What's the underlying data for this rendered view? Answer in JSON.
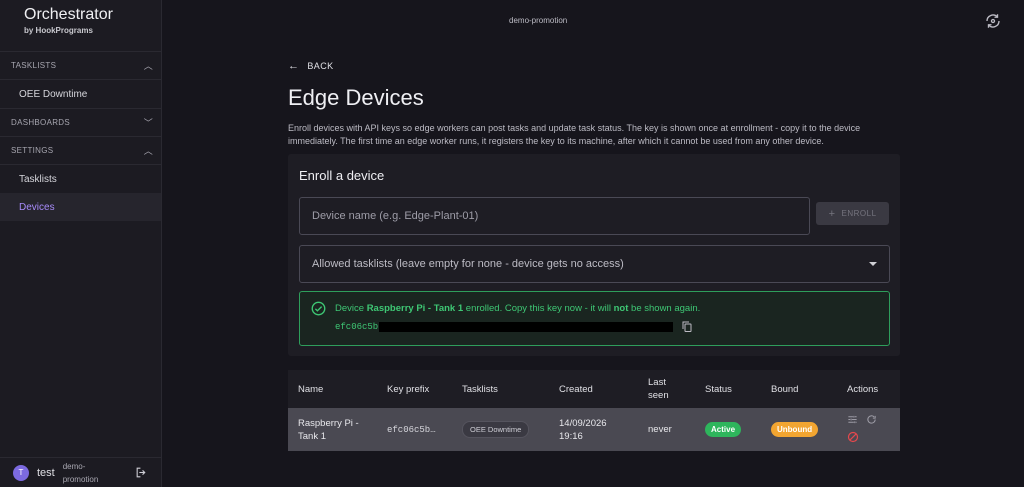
{
  "app": {
    "title": "Orchestrator",
    "subtitle": "by HookPrograms"
  },
  "topbar": {
    "workspace": "demo-promotion"
  },
  "sidebar": {
    "sections": [
      {
        "label": "TASKLISTS",
        "expanded": true,
        "items": [
          "OEE Downtime"
        ]
      },
      {
        "label": "DASHBOARDS",
        "expanded": false,
        "items": []
      },
      {
        "label": "SETTINGS",
        "expanded": true,
        "items": [
          "Tasklists",
          "Devices"
        ]
      }
    ],
    "active_item": "Devices"
  },
  "user": {
    "initial": "T",
    "name": "test",
    "org": "demo-promotion"
  },
  "page": {
    "back_label": "BACK",
    "title": "Edge Devices",
    "description": "Enroll devices with API keys so edge workers can post tasks and update task status. The key is shown once at enrollment - copy it to the device immediately. The first time an edge worker runs, it registers the key to its machine, after which it cannot be used from any other device."
  },
  "enroll": {
    "title": "Enroll a device",
    "name_placeholder": "Device name (e.g. Edge-Plant-01)",
    "name_value": "",
    "button_label": "ENROLL",
    "tasklists_placeholder": "Allowed tasklists (leave empty for none - device gets no access)",
    "success": {
      "prefix": "Device ",
      "device": "Raspberry Pi - Tank 1",
      "middle": " enrolled. Copy this key now - it will ",
      "emph": "not",
      "suffix": " be shown again.",
      "key_visible": "efc06c5b"
    }
  },
  "table": {
    "headers": [
      "Name",
      "Key prefix",
      "Tasklists",
      "Created",
      "Last seen",
      "Status",
      "Bound",
      "Actions"
    ],
    "rows": [
      {
        "name": "Raspberry Pi - Tank 1",
        "key_prefix": "efc06c5b…",
        "tasklist": "OEE Downtime",
        "created": "14/09/2026 19:16",
        "last_seen": "never",
        "status": "Active",
        "bound": "Unbound"
      }
    ]
  },
  "colors": {
    "accent": "#a78bfa",
    "success": "#3ec774",
    "active": "#2eb55c",
    "unbound": "#f2a531",
    "danger": "#e5484d"
  }
}
